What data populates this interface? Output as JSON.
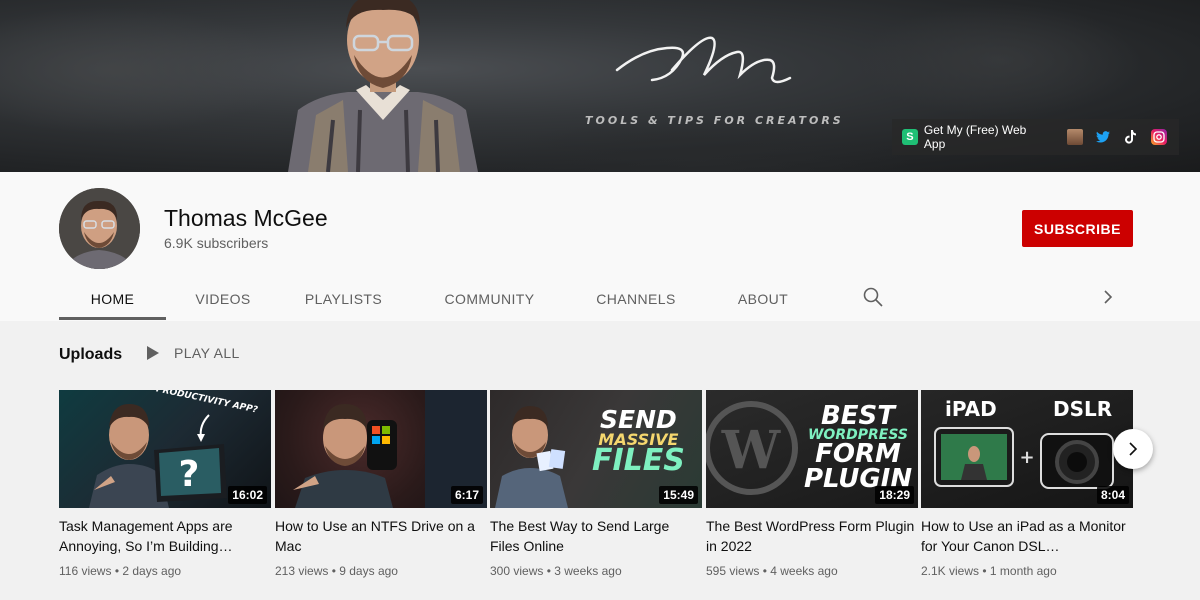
{
  "banner": {
    "tagline": "TOOLS & TIPS FOR CREATORS",
    "web_app_link": "Get My (Free) Web App",
    "social_icons": [
      "person-icon",
      "twitter-icon",
      "tiktok-icon",
      "instagram-icon"
    ]
  },
  "channel": {
    "name": "Thomas McGee",
    "subscribers": "6.9K subscribers",
    "subscribe_label": "SUBSCRIBE"
  },
  "tabs": [
    {
      "label": "HOME",
      "active": true
    },
    {
      "label": "VIDEOS"
    },
    {
      "label": "PLAYLISTS"
    },
    {
      "label": "COMMUNITY"
    },
    {
      "label": "CHANNELS"
    },
    {
      "label": "ABOUT"
    }
  ],
  "uploads": {
    "title": "Uploads",
    "play_all": "PLAY ALL"
  },
  "videos": [
    {
      "title": "Task Management Apps are Annoying, So I’m Building…",
      "duration": "16:02",
      "views": "116 views",
      "age": "2 days ago",
      "thumb_text": "PRODUCTIVITY APP?"
    },
    {
      "title": "How to Use an NTFS Drive on a Mac",
      "duration": "6:17",
      "views": "213 views",
      "age": "9 days ago"
    },
    {
      "title": "The Best Way to Send Large Files Online",
      "duration": "15:49",
      "views": "300 views",
      "age": "3 weeks ago",
      "thumb_text": [
        "SEND",
        "MASSIVE",
        "FILES"
      ]
    },
    {
      "title": "The Best WordPress Form Plugin in 2022",
      "duration": "18:29",
      "views": "595 views",
      "age": "4 weeks ago",
      "thumb_text": [
        "BEST",
        "WORDPRESS",
        "FORM",
        "PLUGIN"
      ]
    },
    {
      "title": "How to Use an iPad as a Monitor for Your Canon DSL…",
      "duration": "8:04",
      "views": "2.1K views",
      "age": "1 month ago",
      "thumb_text": [
        "iPAD",
        "DSLR"
      ]
    }
  ],
  "colors": {
    "subscribe": "#cc0000",
    "text_primary": "#0f0f0f",
    "text_secondary": "#606060",
    "page_bg": "#f9f9f9",
    "content_bg": "#f1f1f1"
  }
}
